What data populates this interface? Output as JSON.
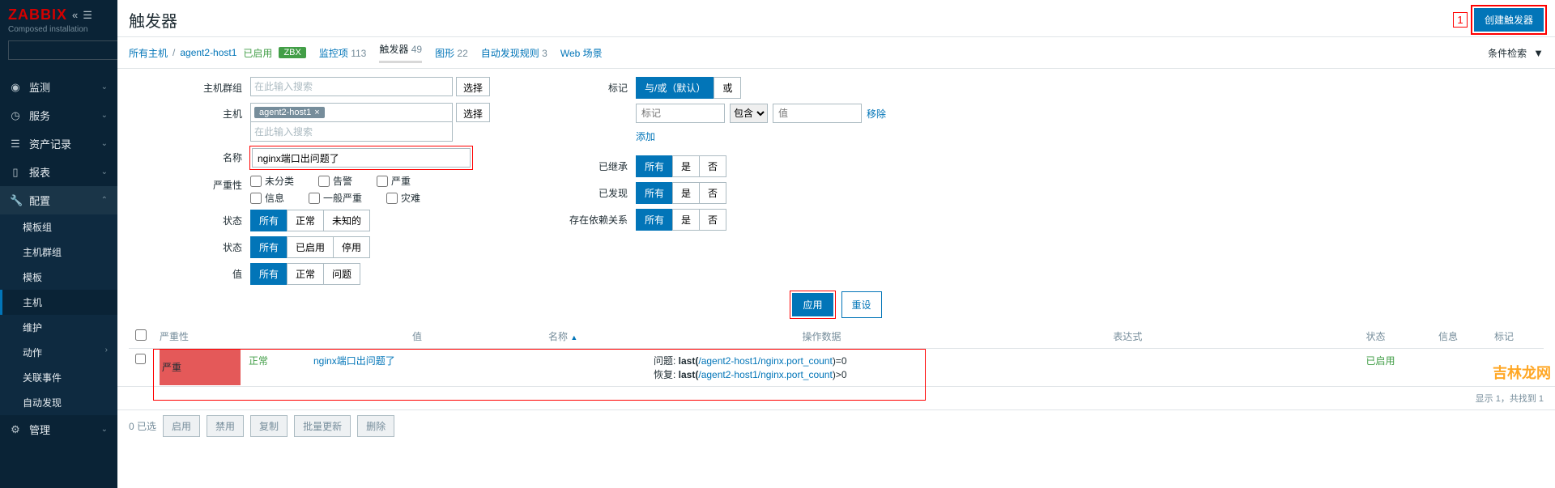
{
  "brand": {
    "logo": "ZABBIX",
    "subtitle": "Composed installation"
  },
  "search": {
    "placeholder": ""
  },
  "nav": {
    "monitor": "监测",
    "services": "服务",
    "inventory": "资产记录",
    "reports": "报表",
    "config": "配置",
    "config_sub": {
      "template_groups": "模板组",
      "host_groups": "主机群组",
      "templates": "模板",
      "hosts": "主机",
      "maintenance": "维护",
      "actions": "动作",
      "events": "关联事件",
      "discovery": "自动发现"
    },
    "admin": "管理"
  },
  "page": {
    "title": "触发器",
    "create_btn": "创建触发器"
  },
  "breadcrumb": {
    "all_hosts": "所有主机",
    "host": "agent2-host1",
    "enabled": "已启用",
    "zbx": "ZBX"
  },
  "tabs": {
    "items": {
      "label": "监控项",
      "count": "113"
    },
    "triggers": {
      "label": "触发器",
      "count": "49"
    },
    "graphs": {
      "label": "图形",
      "count": "22"
    },
    "discovery": {
      "label": "自动发现规则",
      "count": "3"
    },
    "web": {
      "label": "Web 场景"
    }
  },
  "filter_toggle": "条件检索",
  "filter": {
    "hostgroups_label": "主机群组",
    "hostgroups_ph": "在此输入搜索",
    "hosts_label": "主机",
    "hosts_chip": "agent2-host1",
    "hosts_ph": "在此输入搜索",
    "name_label": "名称",
    "name_value": "nginx端口出问题了",
    "severity_label": "严重性",
    "sev_unclassified": "未分类",
    "sev_warning": "告警",
    "sev_high": "严重",
    "sev_info": "信息",
    "sev_average": "一般严重",
    "sev_disaster": "灾难",
    "state_label": "状态",
    "state_all": "所有",
    "state_normal": "正常",
    "state_unknown": "未知的",
    "status_label": "状态",
    "status_all": "所有",
    "status_enabled": "已启用",
    "status_disabled": "停用",
    "value_label": "值",
    "value_all": "所有",
    "value_ok": "正常",
    "value_problem": "问题",
    "tags_label": "标记",
    "tags_andor": "与/或（默认）",
    "tags_or": "或",
    "tag_name_ph": "标记",
    "tag_op": "包含",
    "tag_val_ph": "值",
    "tag_remove": "移除",
    "tag_add": "添加",
    "inherited_label": "已继承",
    "discovered_label": "已发现",
    "deps_label": "存在依赖关系",
    "yn_all": "所有",
    "yn_yes": "是",
    "yn_no": "否",
    "select_btn": "选择",
    "apply": "应用",
    "reset": "重设"
  },
  "table": {
    "col_severity": "严重性",
    "col_value": "值",
    "col_name": "名称",
    "col_opdata": "操作数据",
    "col_expr": "表达式",
    "col_status": "状态",
    "col_info": "信息",
    "col_tags": "标记",
    "row": {
      "severity": "严重",
      "value": "正常",
      "name": "nginx端口出问题了",
      "expr_problem_label": "问题: ",
      "expr_problem_fn": "last(",
      "expr_problem_path": "/agent2-host1/nginx.port_count",
      "expr_problem_suffix": ")=0",
      "expr_recover_label": "恢复: ",
      "expr_recover_fn": "last(",
      "expr_recover_path": "/agent2-host1/nginx.port_count",
      "expr_recover_suffix": ")>0",
      "status": "已启用"
    },
    "footer": "显示 1，共找到 1"
  },
  "bottom": {
    "selected": "0 已选",
    "enable": "启用",
    "disable": "禁用",
    "copy": "复制",
    "massupdate": "批量更新",
    "delete": "删除"
  },
  "watermark": "吉林龙网"
}
